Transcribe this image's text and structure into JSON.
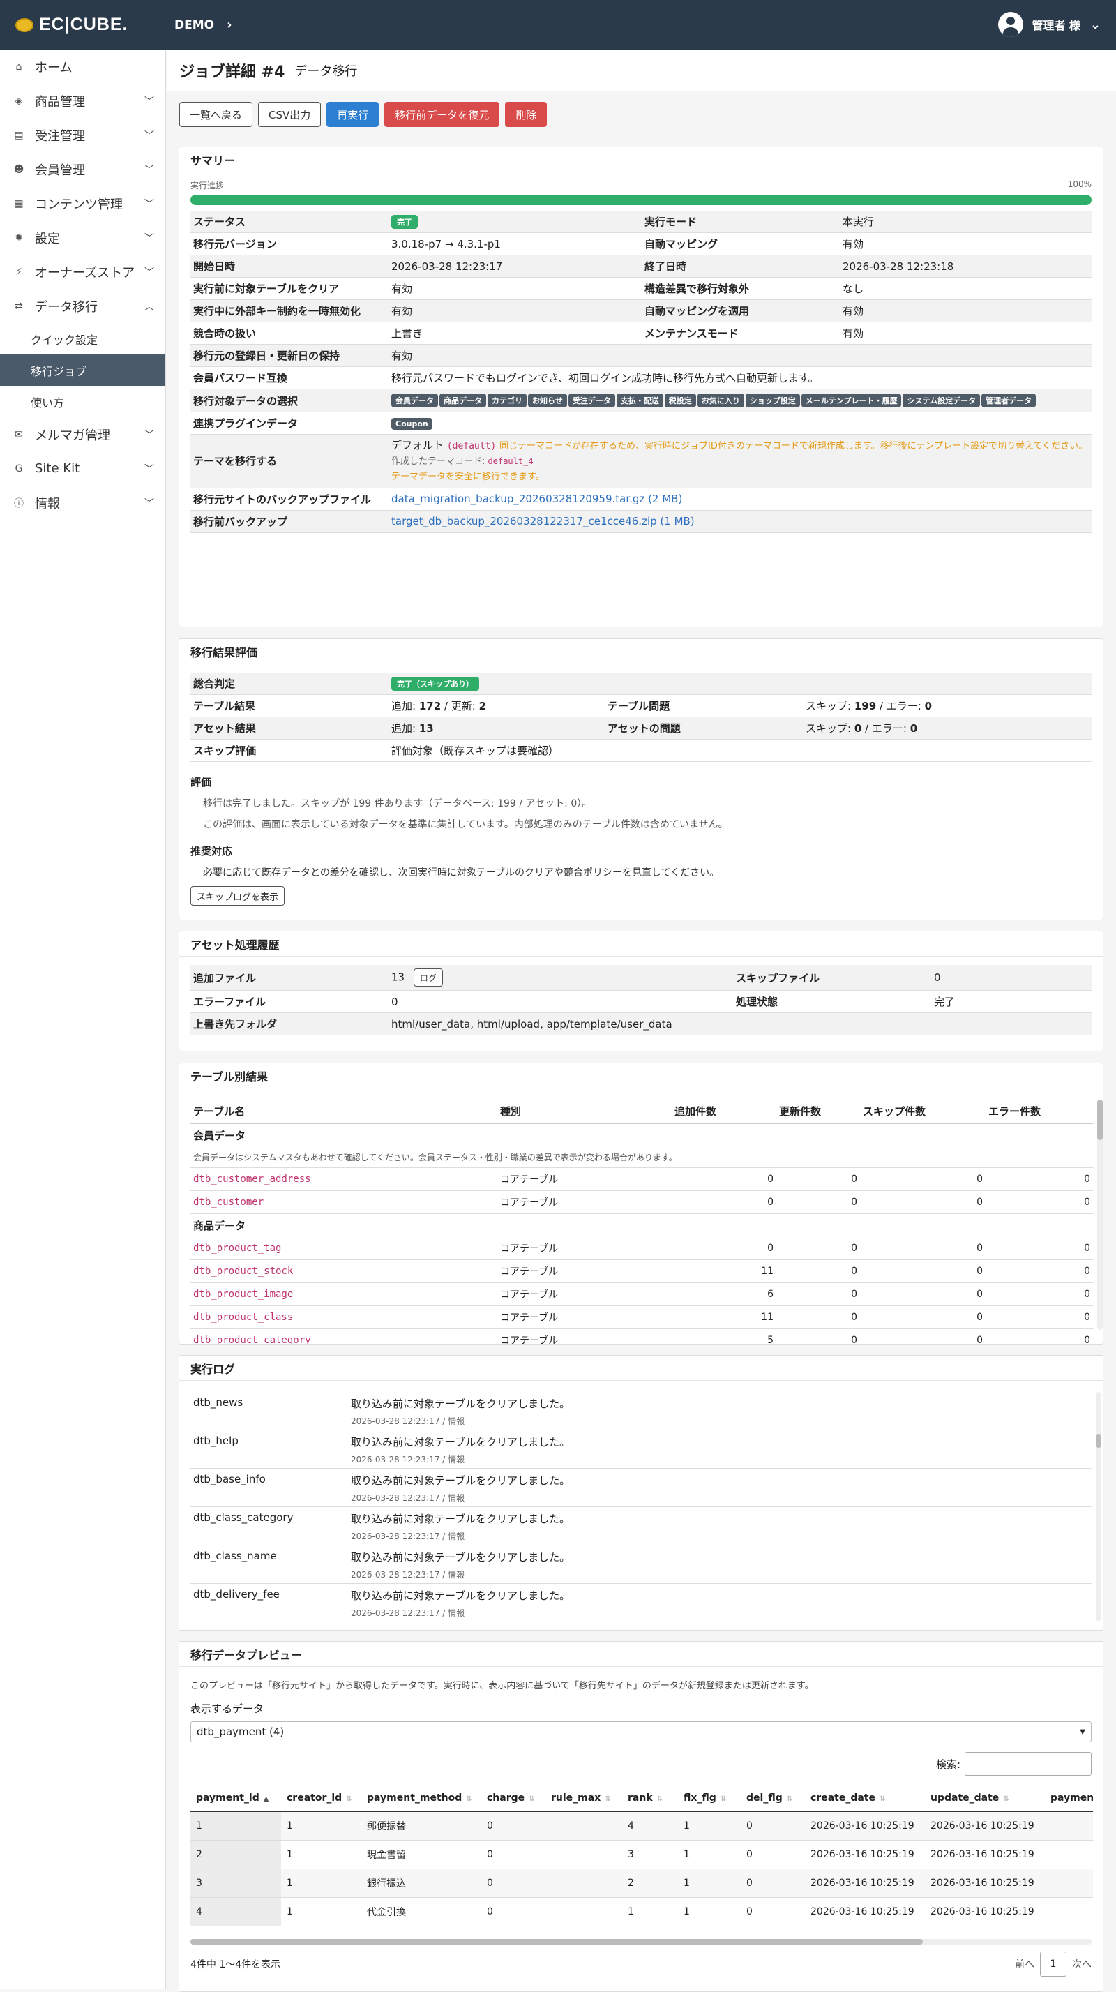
{
  "header": {
    "logo": "EC|CUBE.",
    "shop": "DEMO",
    "user": "管理者 様"
  },
  "sidebar": {
    "items": [
      {
        "label": "ホーム",
        "icon": "home-icon",
        "glyph": "⌂",
        "expand": false
      },
      {
        "label": "商品管理",
        "icon": "cube-icon",
        "glyph": "◈",
        "expand": true
      },
      {
        "label": "受注管理",
        "icon": "cart-icon",
        "glyph": "▤",
        "expand": true
      },
      {
        "label": "会員管理",
        "icon": "users-icon",
        "glyph": "☻",
        "expand": true
      },
      {
        "label": "コンテンツ管理",
        "icon": "file-icon",
        "glyph": "▦",
        "expand": true
      },
      {
        "label": "設定",
        "icon": "gear-icon",
        "glyph": "✹",
        "expand": true
      },
      {
        "label": "オーナーズストア",
        "icon": "plug-icon",
        "glyph": "⚡",
        "expand": true
      },
      {
        "label": "データ移行",
        "icon": "shuffle-icon",
        "glyph": "⇄",
        "expand": true,
        "open": true
      }
    ],
    "subitems": [
      "クイック設定",
      "移行ジョブ",
      "使い方"
    ],
    "items2": [
      {
        "label": "メルマガ管理",
        "icon": "mail-icon",
        "glyph": "✉"
      },
      {
        "label": "Site Kit",
        "icon": "google-icon",
        "glyph": "G"
      },
      {
        "label": "情報",
        "icon": "info-icon",
        "glyph": "ⓘ"
      }
    ]
  },
  "page": {
    "title": "ジョブ詳細 #4",
    "subtitle": "データ移行"
  },
  "buttons": {
    "back": "一覧へ戻る",
    "csv": "CSV出力",
    "rerun": "再実行",
    "restore": "移行前データを復元",
    "delete": "削除"
  },
  "summary": {
    "title": "サマリー",
    "progress_label": "実行進捗",
    "progress_value": "100%",
    "progress": 1.0,
    "status_k": "ステータス",
    "status_v": "完了",
    "mode_k": "実行モード",
    "mode_v": "本実行",
    "version_k": "移行元バージョン",
    "version_v": "3.0.18-p7 → 4.3.1-p1",
    "automap_k": "自動マッピング",
    "automap_v": "有効",
    "start_k": "開始日時",
    "start_v": "2026-03-28 12:23:17",
    "end_k": "終了日時",
    "end_v": "2026-03-28 12:23:18",
    "clear_k": "実行前に対象テーブルをクリア",
    "clear_v": "有効",
    "diff_k": "構造差異で移行対象外",
    "diff_v": "なし",
    "fk_k": "実行中に外部キー制約を一時無効化",
    "fk_v": "有効",
    "applymap_k": "自動マッピングを適用",
    "applymap_v": "有効",
    "conflict_k": "競合時の扱い",
    "conflict_v": "上書き",
    "maint_k": "メンテナンスモード",
    "maint_v": "有効",
    "keepdate_k": "移行元の登録日・更新日の保持",
    "keepdate_v": "有効",
    "pw_k": "会員パスワード互換",
    "pw_v": "移行元パスワードでもログインでき、初回ログイン成功時に移行先方式へ自動更新します。",
    "select_k": "移行対象データの選択",
    "tags": [
      "会員データ",
      "商品データ",
      "カテゴリ",
      "お知らせ",
      "受注データ",
      "支払・配送",
      "税設定",
      "お気に入り",
      "ショップ設定",
      "メールテンプレート・履歴",
      "システム設定データ",
      "管理者データ"
    ],
    "plugin_k": "連携プラグインデータ",
    "plugin_tag": "Coupon",
    "theme_k": "テーマを移行する",
    "theme_default": "デフォルト",
    "theme_code": "(default)",
    "theme_note": "同じテーマコードが存在するため、実行時にジョブID付きのテーマコードで新規作成します。移行後にテンプレート設定で切り替えてください。",
    "theme_created": "作成したテーマコード: ",
    "theme_created_code": "default_4",
    "theme_safe": "テーマデータを安全に移行できます。",
    "srcbk_k": "移行元サイトのバックアップファイル",
    "srcbk_v": "data_migration_backup_20260328120959.tar.gz (2 MB)",
    "prebk_k": "移行前バックアップ",
    "prebk_v": "target_db_backup_20260328122317_ce1cce46.zip (1 MB)"
  },
  "eval": {
    "title": "移行結果評価",
    "overall_k": "総合判定",
    "overall_v": "完了（スキップあり）",
    "table_k": "テーブル結果",
    "table_v1": "追加: ",
    "table_n1": "172",
    "table_v2": " / 更新: ",
    "table_n2": "2",
    "tprob_k": "テーブル問題",
    "tprob_v1": "スキップ: ",
    "tprob_n1": "199",
    "tprob_v2": " / エラー: ",
    "tprob_n2": "0",
    "asset_k": "アセット結果",
    "asset_v1": "追加: ",
    "asset_n1": "13",
    "aprob_k": "アセットの問題",
    "aprob_v1": "スキップ: ",
    "aprob_n1": "0",
    "aprob_v2": " / エラー: ",
    "aprob_n2": "0",
    "skip_k": "スキップ評価",
    "skip_v": "評価対象（既存スキップは要確認）",
    "h1": "評価",
    "p1": "移行は完了しました。スキップが 199 件あります（データベース: 199 / アセット: 0）。",
    "p2": "この評価は、画面に表示している対象データを基準に集計しています。内部処理のみのテーブル件数は含めていません。",
    "h2": "推奨対応",
    "p3": "必要に応じて既存データとの差分を確認し、次回実行時に対象テーブルのクリアや競合ポリシーを見直してください。",
    "skiplog": "スキップログを表示"
  },
  "assets": {
    "title": "アセット処理履歴",
    "add_k": "追加ファイル",
    "add_v": "13",
    "log_btn": "ログ",
    "skipf_k": "スキップファイル",
    "skipf_v": "0",
    "err_k": "エラーファイル",
    "err_v": "0",
    "state_k": "処理状態",
    "state_v": "完了",
    "dest_k": "上書き先フォルダ",
    "dest_v": "html/user_data, html/upload, app/template/user_data"
  },
  "tables": {
    "title": "テーブル別結果",
    "cols": [
      "テーブル名",
      "種別",
      "追加件数",
      "更新件数",
      "スキップ件数",
      "エラー件数"
    ],
    "group1": "会員データ",
    "note1": "会員データはシステムマスタもあわせて確認してください。会員ステータス・性別・職業の差異で表示が変わる場合があります。",
    "rows1": [
      [
        "dtb_customer_address",
        "コアテーブル",
        "0",
        "0",
        "0",
        "0"
      ],
      [
        "dtb_customer",
        "コアテーブル",
        "0",
        "0",
        "0",
        "0"
      ]
    ],
    "group2": "商品データ",
    "rows2": [
      [
        "dtb_product_tag",
        "コアテーブル",
        "0",
        "0",
        "0",
        "0"
      ],
      [
        "dtb_product_stock",
        "コアテーブル",
        "11",
        "0",
        "0",
        "0"
      ],
      [
        "dtb_product_image",
        "コアテーブル",
        "6",
        "0",
        "0",
        "0"
      ],
      [
        "dtb_product_class",
        "コアテーブル",
        "11",
        "0",
        "0",
        "0"
      ],
      [
        "dtb_product_category",
        "コアテーブル",
        "5",
        "0",
        "0",
        "0"
      ]
    ]
  },
  "log": {
    "title": "実行ログ",
    "rows": [
      [
        "dtb_news",
        "取り込み前に対象テーブルをクリアしました。",
        "2026-03-28 12:23:17 / 情報"
      ],
      [
        "dtb_help",
        "取り込み前に対象テーブルをクリアしました。",
        "2026-03-28 12:23:17 / 情報"
      ],
      [
        "dtb_base_info",
        "取り込み前に対象テーブルをクリアしました。",
        "2026-03-28 12:23:17 / 情報"
      ],
      [
        "dtb_class_category",
        "取り込み前に対象テーブルをクリアしました。",
        "2026-03-28 12:23:17 / 情報"
      ],
      [
        "dtb_class_name",
        "取り込み前に対象テーブルをクリアしました。",
        "2026-03-28 12:23:17 / 情報"
      ],
      [
        "dtb_delivery_fee",
        "取り込み前に対象テーブルをクリアしました。",
        "2026-03-28 12:23:17 / 情報"
      ]
    ]
  },
  "preview": {
    "title": "移行データプレビュー",
    "desc": "このプレビューは「移行元サイト」から取得したデータです。実行時に、表示内容に基づいて「移行先サイト」のデータが新規登録または更新されます。",
    "select_label": "表示するデータ",
    "select_value": "dtb_payment (4)",
    "search_label": "検索:",
    "search_value": "",
    "cols": [
      "payment_id",
      "creator_id",
      "payment_method",
      "charge",
      "rule_max",
      "rank",
      "fix_flg",
      "del_flg",
      "create_date",
      "update_date",
      "payment_"
    ],
    "rows": [
      [
        "1",
        "1",
        "郵便振替",
        "0",
        "",
        "4",
        "1",
        "0",
        "2026-03-16 10:25:19",
        "2026-03-16 10:25:19",
        ""
      ],
      [
        "2",
        "1",
        "現金書留",
        "0",
        "",
        "3",
        "1",
        "0",
        "2026-03-16 10:25:19",
        "2026-03-16 10:25:19",
        ""
      ],
      [
        "3",
        "1",
        "銀行振込",
        "0",
        "",
        "2",
        "1",
        "0",
        "2026-03-16 10:25:19",
        "2026-03-16 10:25:19",
        ""
      ],
      [
        "4",
        "1",
        "代金引換",
        "0",
        "",
        "1",
        "1",
        "0",
        "2026-03-16 10:25:19",
        "2026-03-16 10:25:19",
        ""
      ]
    ],
    "info": "4件中 1〜4件を表示",
    "prev": "前へ",
    "page": "1",
    "next": "次へ"
  }
}
